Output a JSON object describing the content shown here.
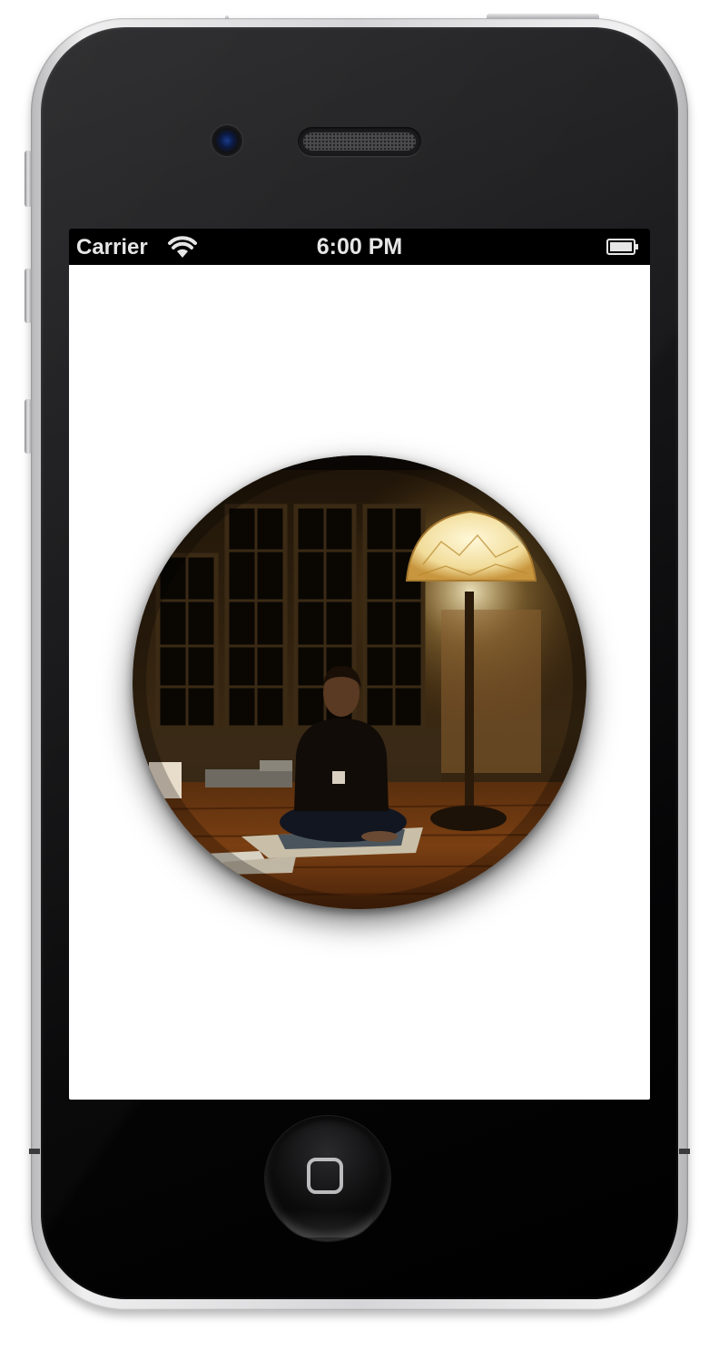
{
  "status_bar": {
    "carrier": "Carrier",
    "time": "6:00 PM",
    "wifi_icon": "wifi-icon",
    "battery_icon": "battery-icon"
  },
  "content": {
    "image_shape": "circle",
    "image_subject": "photo"
  },
  "device": {
    "home_button_icon": "home-square-icon"
  },
  "colors": {
    "status_bar_bg": "#000000",
    "status_text": "#e6e6e6",
    "screen_bg": "#ffffff",
    "lamp_glow": "#f2e6b0"
  }
}
